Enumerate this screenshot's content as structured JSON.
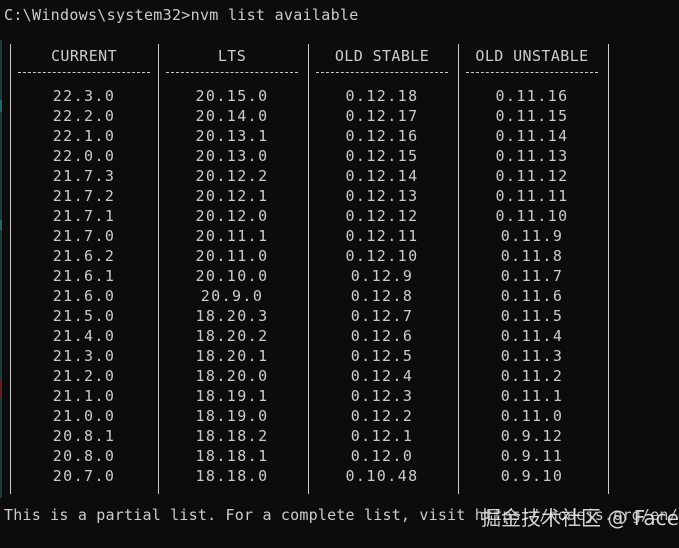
{
  "prompt": "C:\\Windows\\system32>nvm list available",
  "columns": [
    {
      "header": "CURRENT",
      "values": [
        "22.3.0",
        "22.2.0",
        "22.1.0",
        "22.0.0",
        "21.7.3",
        "21.7.2",
        "21.7.1",
        "21.7.0",
        "21.6.2",
        "21.6.1",
        "21.6.0",
        "21.5.0",
        "21.4.0",
        "21.3.0",
        "21.2.0",
        "21.1.0",
        "21.0.0",
        "20.8.1",
        "20.8.0",
        "20.7.0"
      ]
    },
    {
      "header": "LTS",
      "values": [
        "20.15.0",
        "20.14.0",
        "20.13.1",
        "20.13.0",
        "20.12.2",
        "20.12.1",
        "20.12.0",
        "20.11.1",
        "20.11.0",
        "20.10.0",
        "20.9.0",
        "18.20.3",
        "18.20.2",
        "18.20.1",
        "18.20.0",
        "18.19.1",
        "18.19.0",
        "18.18.2",
        "18.18.1",
        "18.18.0"
      ]
    },
    {
      "header": "OLD STABLE",
      "values": [
        "0.12.18",
        "0.12.17",
        "0.12.16",
        "0.12.15",
        "0.12.14",
        "0.12.13",
        "0.12.12",
        "0.12.11",
        "0.12.10",
        "0.12.9",
        "0.12.8",
        "0.12.7",
        "0.12.6",
        "0.12.5",
        "0.12.4",
        "0.12.3",
        "0.12.2",
        "0.12.1",
        "0.12.0",
        "0.10.48"
      ]
    },
    {
      "header": "OLD UNSTABLE",
      "values": [
        "0.11.16",
        "0.11.15",
        "0.11.14",
        "0.11.13",
        "0.11.12",
        "0.11.11",
        "0.11.10",
        "0.11.9",
        "0.11.8",
        "0.11.7",
        "0.11.6",
        "0.11.5",
        "0.11.4",
        "0.11.3",
        "0.11.2",
        "0.11.1",
        "0.11.0",
        "0.9.12",
        "0.9.11",
        "0.9.10"
      ]
    }
  ],
  "footer": "This is a partial list. For a complete list, visit https://nodejs.org/en/download/releases",
  "watermark": "掘金技术社区 @ Face",
  "colors": {
    "background": "#0c0c0c",
    "text": "#cccccc"
  }
}
